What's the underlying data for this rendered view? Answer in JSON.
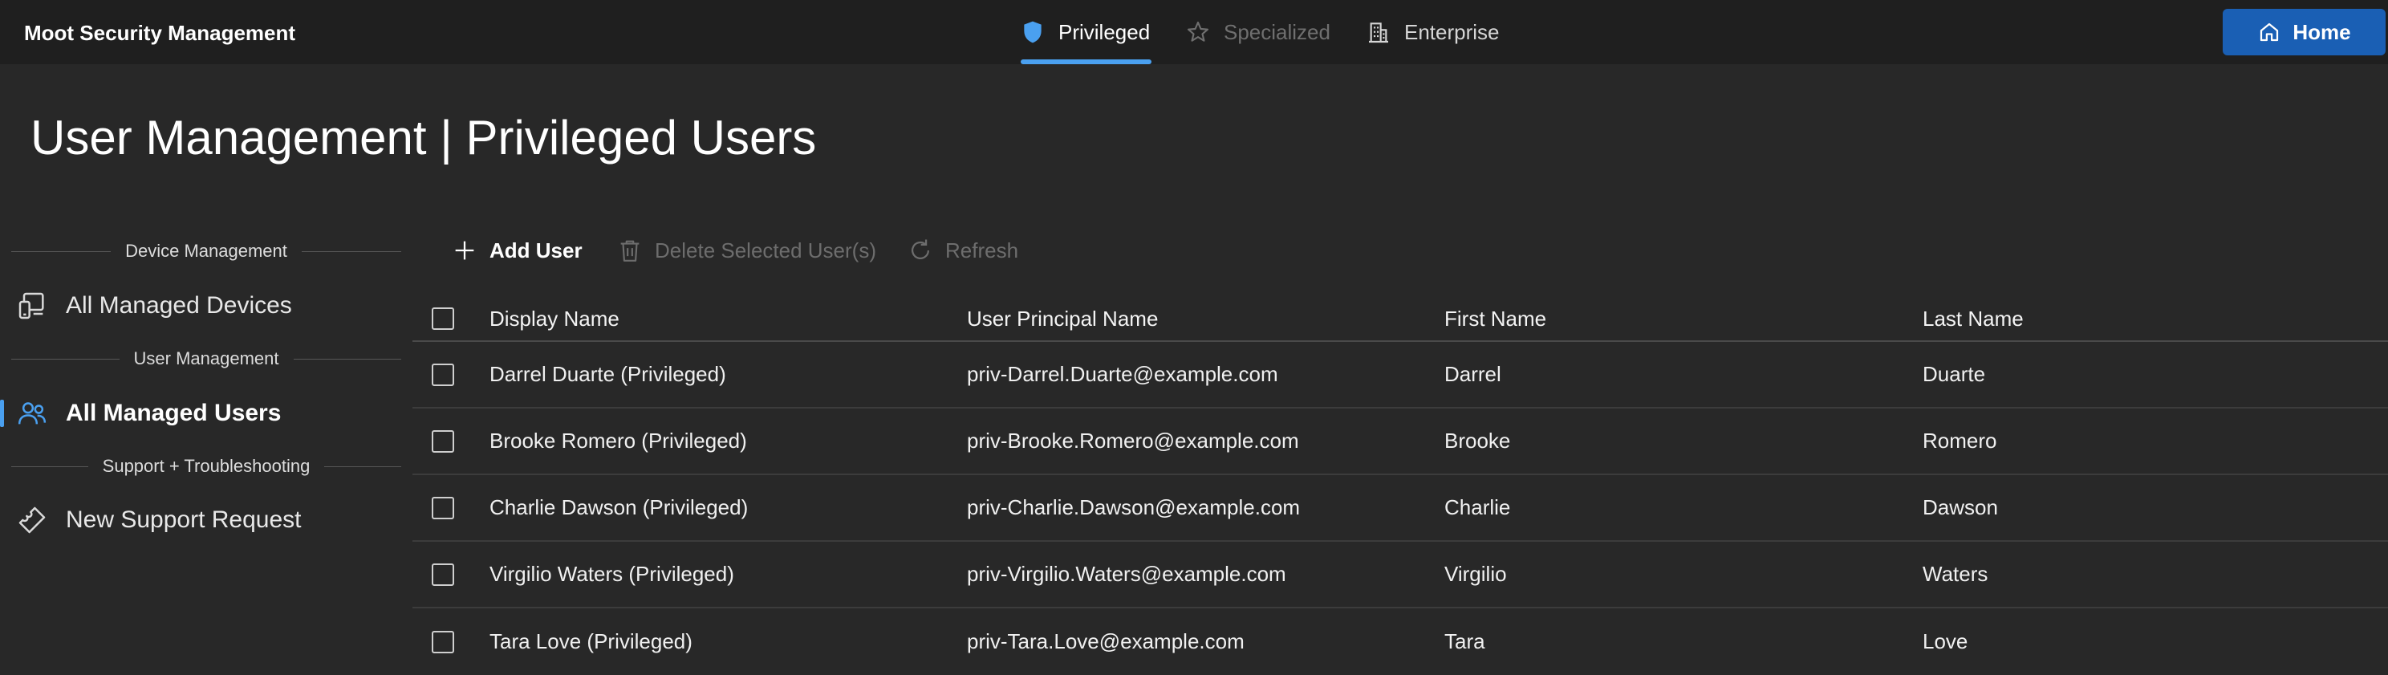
{
  "header": {
    "app_title": "Moot Security Management",
    "tabs": [
      {
        "label": "Privileged",
        "icon": "shield-icon",
        "active": true
      },
      {
        "label": "Specialized",
        "icon": "star-icon",
        "active": false
      },
      {
        "label": "Enterprise",
        "icon": "building-icon",
        "active": false
      }
    ],
    "home_label": "Home"
  },
  "page": {
    "title": "User Management | Privileged Users"
  },
  "sidebar": {
    "sections": [
      {
        "label": "Device Management",
        "items": [
          {
            "label": "All Managed Devices",
            "icon": "devices-icon"
          }
        ]
      },
      {
        "label": "User Management",
        "items": [
          {
            "label": "All Managed Users",
            "icon": "users-icon",
            "active": true
          }
        ]
      },
      {
        "label": "Support + Troubleshooting",
        "items": [
          {
            "label": "New Support Request",
            "icon": "ticket-icon"
          }
        ]
      }
    ]
  },
  "toolbar": {
    "add_label": "Add User",
    "delete_label": "Delete Selected User(s)",
    "refresh_label": "Refresh"
  },
  "table": {
    "columns": [
      "Display Name",
      "User Principal Name",
      "First Name",
      "Last Name"
    ],
    "rows": [
      [
        "Darrel Duarte (Privileged)",
        "priv-Darrel.Duarte@example.com",
        "Darrel",
        "Duarte"
      ],
      [
        "Brooke Romero (Privileged)",
        "priv-Brooke.Romero@example.com",
        "Brooke",
        "Romero"
      ],
      [
        "Charlie Dawson (Privileged)",
        "priv-Charlie.Dawson@example.com",
        "Charlie",
        "Dawson"
      ],
      [
        "Virgilio Waters (Privileged)",
        "priv-Virgilio.Waters@example.com",
        "Virgilio",
        "Waters"
      ],
      [
        "Tara Love (Privileged)",
        "priv-Tara.Love@example.com",
        "Tara",
        "Love"
      ]
    ]
  },
  "colors": {
    "accent": "#4aa0f0",
    "home_button": "#1a5fb4",
    "background": "#282828",
    "topbar": "#1f1f1f"
  }
}
